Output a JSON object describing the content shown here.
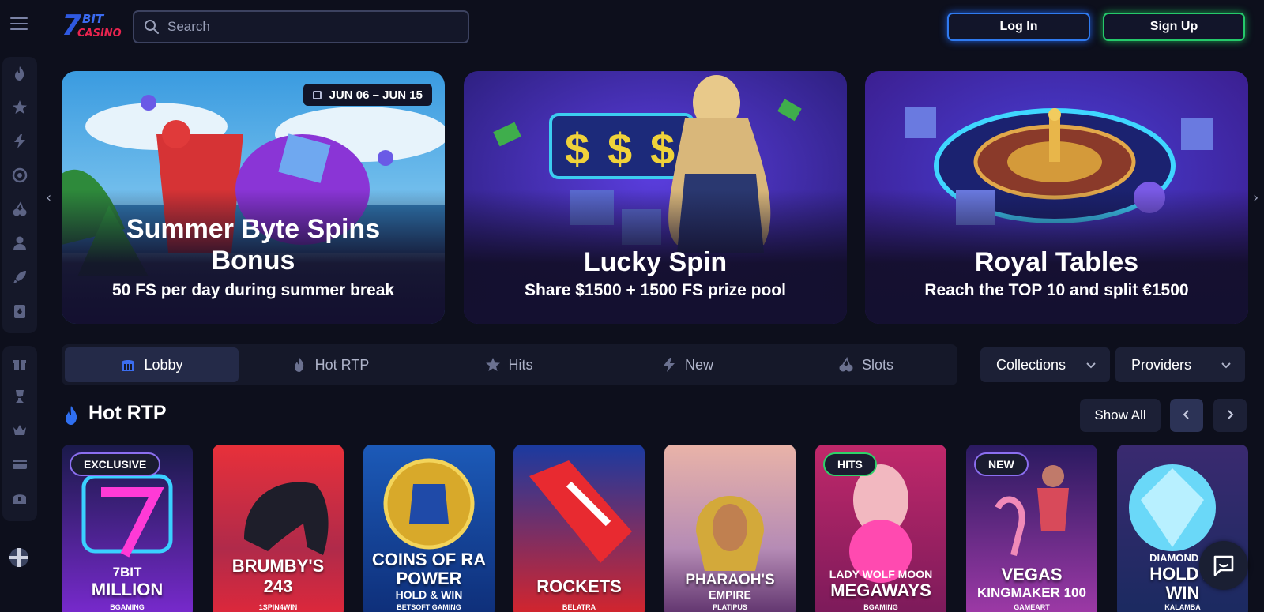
{
  "header": {
    "logo": {
      "seven": "7",
      "bit": "BIT",
      "casino": "CASINO"
    },
    "search_placeholder": "Search",
    "login_label": "Log In",
    "signup_label": "Sign Up"
  },
  "sidebar": {
    "groups": [
      [
        "fire-icon",
        "star-icon",
        "lightning-icon",
        "target-icon",
        "cherries-icon",
        "dealer-icon",
        "rocket-icon",
        "cards-icon"
      ],
      [
        "gift-icon",
        "trophy-icon",
        "crown-icon",
        "card-icon",
        "chest-icon"
      ]
    ],
    "language_icon": "uk-flag-icon"
  },
  "banners": [
    {
      "title_line1": "Summer Byte Spins",
      "title_line2": "Bonus",
      "subtitle": "50 FS per day during summer break",
      "date_badge": "JUN 06 – JUN 15"
    },
    {
      "title": "Lucky Spin",
      "subtitle": "Share $1500 + 1500 FS prize pool"
    },
    {
      "title": "Royal Tables",
      "subtitle": "Reach the TOP 10 and split €1500"
    }
  ],
  "tabs": [
    {
      "label": "Lobby",
      "icon": "lobby-icon",
      "active": true
    },
    {
      "label": "Hot RTP",
      "icon": "fire-icon"
    },
    {
      "label": "Hits",
      "icon": "star-icon"
    },
    {
      "label": "New",
      "icon": "lightning-icon"
    },
    {
      "label": "Slots",
      "icon": "cherries-icon"
    }
  ],
  "dropdowns": {
    "collections": "Collections",
    "providers": "Providers"
  },
  "section": {
    "title": "Hot RTP",
    "show_all": "Show All"
  },
  "games": [
    {
      "badge": "EXCLUSIVE",
      "line1": "7BIT",
      "line2": "MILLION",
      "provider": "BGAMING"
    },
    {
      "badge": "",
      "line1": "BRUMBY'S",
      "line2": "243",
      "provider": "1SPIN4WIN"
    },
    {
      "badge": "",
      "line1": "COINS OF RA",
      "line2": "POWER",
      "line3": "HOLD & WIN",
      "provider": "BETSOFT GAMING"
    },
    {
      "badge": "",
      "line1": "ROCKETS",
      "provider": "BELATRA"
    },
    {
      "badge": "",
      "line1": "PHARAOH'S",
      "line2": "EMPIRE",
      "provider": "PLATIPUS"
    },
    {
      "badge": "HITS",
      "line1": "LADY WOLF MOON",
      "line2": "MEGAWAYS",
      "provider": "BGAMING"
    },
    {
      "badge": "NEW",
      "line1": "VEGAS",
      "line2": "KINGMAKER 100",
      "provider": "GAMEART"
    },
    {
      "badge": "",
      "line1": "DIAMOND SU",
      "line2": "HOLD A",
      "line3": "WIN",
      "provider": "KALAMBA"
    }
  ],
  "colors": {
    "background": "#0d0f1c",
    "login_border": "#2f7af0",
    "signup_border": "#25c96a",
    "panel": "#151829"
  }
}
